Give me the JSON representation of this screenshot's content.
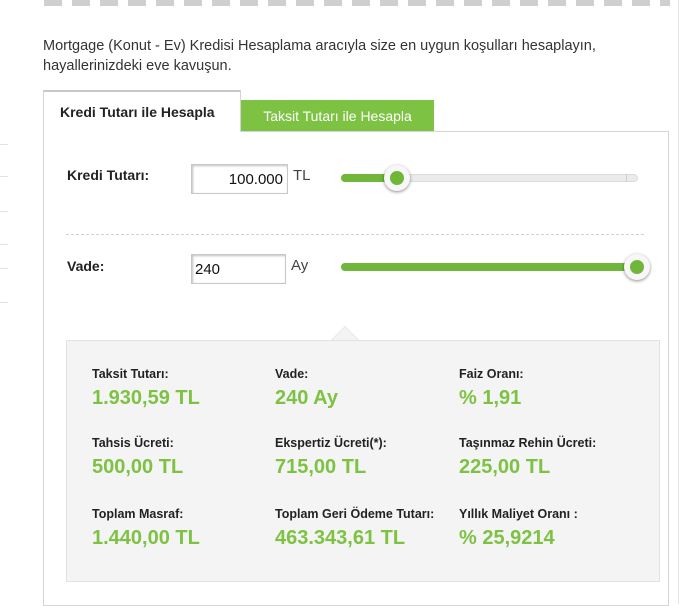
{
  "intro_text": "Mortgage (Konut - Ev) Kredisi Hesaplama aracıyla size en uygun koşulları hesaplayın, hayallerinizdeki eve kavuşun.",
  "tabs": [
    {
      "label": "Kredi Tutarı ile Hesapla",
      "active": true
    },
    {
      "label": "Taksit Tutarı ile Hesapla",
      "active": false
    }
  ],
  "loan": {
    "label": "Kredi Tutarı:",
    "value": "100.000",
    "unit": "TL",
    "slider_fraction": 0.19
  },
  "term": {
    "label": "Vade:",
    "value": "240",
    "unit": "Ay",
    "slider_fraction": 1.0
  },
  "results": [
    {
      "label": "Taksit Tutarı:",
      "value": "1.930,59 TL"
    },
    {
      "label": "Vade:",
      "value": "240 Ay"
    },
    {
      "label": "Faiz Oranı:",
      "value": "% 1,91"
    },
    {
      "label": "Tahsis Ücreti:",
      "value": "500,00 TL"
    },
    {
      "label": "Ekspertiz Ücreti(*):",
      "value": "715,00 TL"
    },
    {
      "label": "Taşınmaz Rehin Ücreti:",
      "value": "225,00 TL"
    },
    {
      "label": "Toplam Masraf:",
      "value": "1.440,00 TL"
    },
    {
      "label": "Toplam Geri Ödeme Tutarı:",
      "value": "463.343,61 TL"
    },
    {
      "label": "Yıllık Maliyet Oranı :",
      "value": "% 25,9214"
    }
  ],
  "colors": {
    "accent": "#7dc242",
    "slider": "#6fb63b"
  }
}
